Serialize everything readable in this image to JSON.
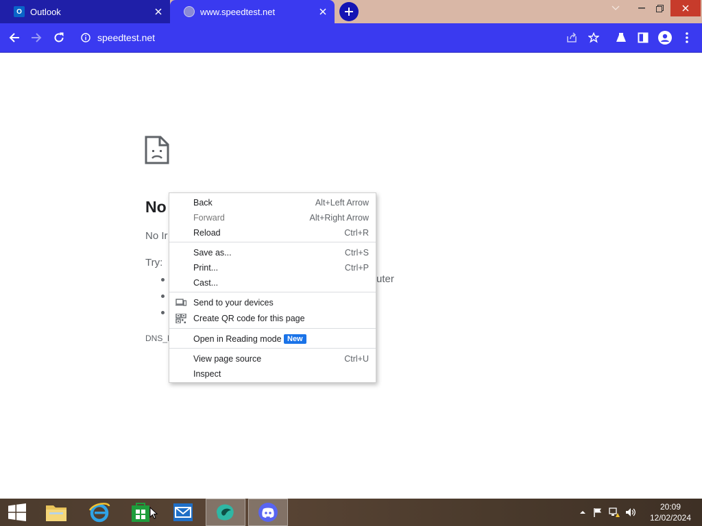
{
  "tabs": [
    {
      "title": "Outlook"
    },
    {
      "title": "www.speedtest.net"
    }
  ],
  "omnibox": {
    "url": "speedtest.net"
  },
  "error_page": {
    "heading": "No",
    "text": "No Ir",
    "try_label": "Try:",
    "tail_text": "uter",
    "code": "DNS_F"
  },
  "context_menu": {
    "items": [
      {
        "label": "Back",
        "shortcut": "Alt+Left Arrow"
      },
      {
        "label": "Forward",
        "shortcut": "Alt+Right Arrow"
      },
      {
        "label": "Reload",
        "shortcut": "Ctrl+R"
      },
      {
        "label": "Save as...",
        "shortcut": "Ctrl+S"
      },
      {
        "label": "Print...",
        "shortcut": "Ctrl+P"
      },
      {
        "label": "Cast..."
      },
      {
        "label": "Send to your devices"
      },
      {
        "label": "Create QR code for this page"
      },
      {
        "label": "Open in Reading mode",
        "badge": "New"
      },
      {
        "label": "View page source",
        "shortcut": "Ctrl+U"
      },
      {
        "label": "Inspect"
      }
    ]
  },
  "taskbar": {
    "clock_time": "20:09",
    "clock_date": "12/02/2024"
  },
  "colors": {
    "toolbar": "#3a3af0",
    "active_tab": "#3a3af0",
    "inactive_tab": "#1f1fa8",
    "badge_blue": "#1a73e8",
    "close_red": "#c73b2b"
  }
}
